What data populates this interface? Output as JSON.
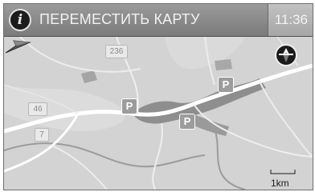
{
  "header": {
    "title": "ПЕРЕМЕСТИТЬ КАРТУ",
    "time": "11:36",
    "info_icon": "info-icon"
  },
  "map": {
    "road_labels": [
      "236",
      "46",
      "7"
    ],
    "parking_labels": [
      "P",
      "P",
      "P"
    ],
    "compass_icon": "compass-icon",
    "cursor_icon": "map-cursor-arrow-icon",
    "scale": {
      "label": "1km"
    },
    "colors": {
      "land": "#d2d2d2",
      "roads": "#ffffff",
      "urban": "#8e8e8e",
      "water": "#9a9a9a"
    }
  }
}
